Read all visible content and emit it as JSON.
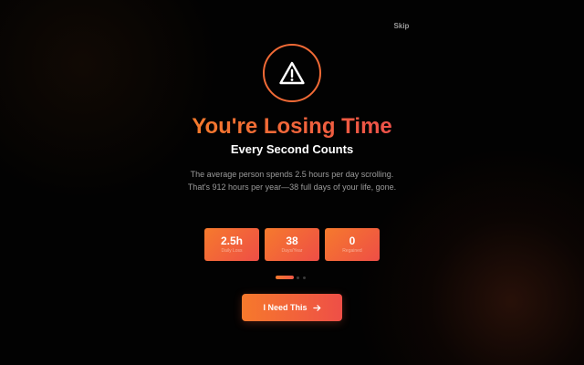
{
  "skip_label": "Skip",
  "hero": {
    "icon": "warning-triangle-icon",
    "title": "You're Losing Time",
    "subtitle": "Every Second Counts",
    "description": "The average person spends 2.5 hours per day scrolling. That's 912 hours per year—38 full days of your life, gone."
  },
  "stats": [
    {
      "value": "2.5h",
      "label": "Daily Loss"
    },
    {
      "value": "38",
      "label": "Days/Year"
    },
    {
      "value": "0",
      "label": "Regained"
    }
  ],
  "pagination": {
    "current": 1,
    "total": 3
  },
  "cta": {
    "label": "I Need This",
    "icon": "arrow-right-icon"
  },
  "colors": {
    "accent_start": "#f6792c",
    "accent_end": "#ee4f47",
    "background": "#020202"
  }
}
